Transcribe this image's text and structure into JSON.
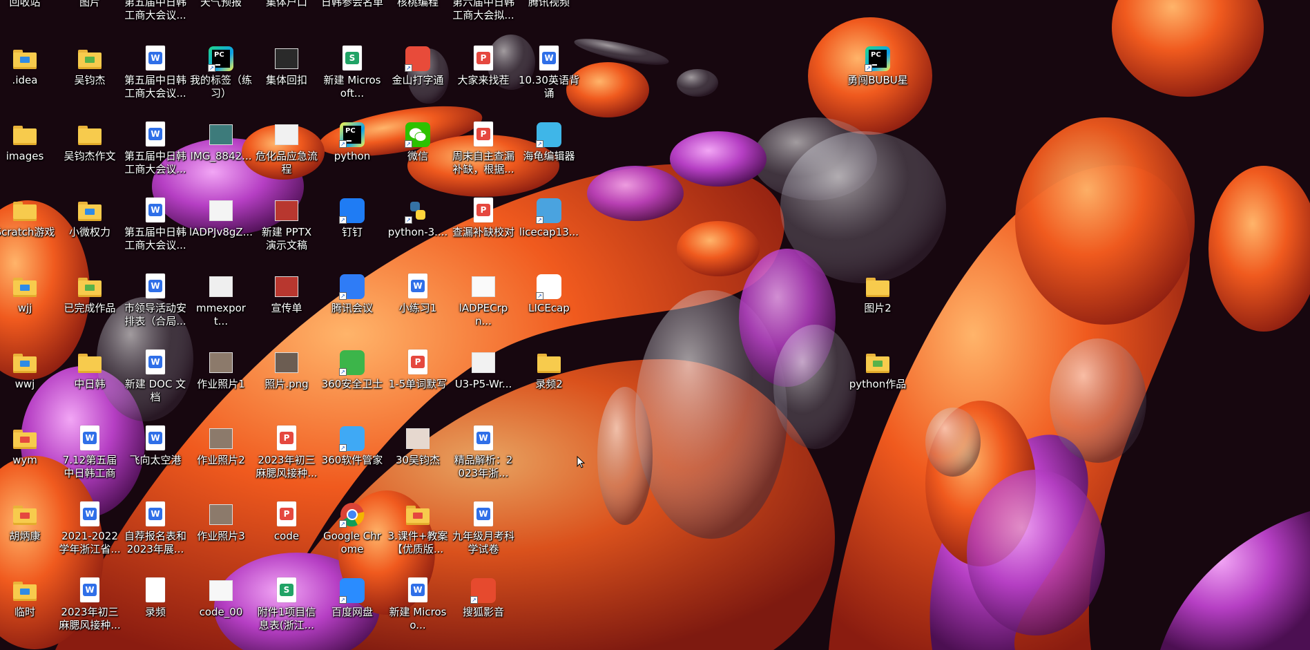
{
  "desktop": {
    "top_row": [
      "回收站",
      "图片",
      "第五届中日韩工商大会议...",
      "天气预报",
      "集体户口",
      "日韩参会名单",
      "核桃编程",
      "第六届中日韩工商大会拟...",
      "腾讯视频"
    ],
    "icons": [
      {
        "label": ".idea",
        "kind": "folder",
        "color": "#2f8be6"
      },
      {
        "label": "吴钧杰",
        "kind": "folder",
        "color": "#58b24a"
      },
      {
        "label": "第五届中日韩工商大会议...",
        "kind": "wps-doc",
        "color": "#2f6fe8"
      },
      {
        "label": "我的标签（练习）",
        "kind": "pycharm",
        "color": "#21d789"
      },
      {
        "label": "集体回扣",
        "kind": "image",
        "color": "#2a2a2a"
      },
      {
        "label": "新建 Microsoft...",
        "kind": "wps-sheet",
        "color": "#21a366"
      },
      {
        "label": "金山打字通",
        "kind": "app",
        "color": "#e84b3a"
      },
      {
        "label": "大家来找茬",
        "kind": "wps-pdf",
        "color": "#e5483f"
      },
      {
        "label": "10.30英语背诵",
        "kind": "wps-doc",
        "color": "#2f6fe8"
      },
      {
        "label": "勇闯BUBU星",
        "kind": "pycharm",
        "color": "#21d789"
      },
      {
        "label": "images",
        "kind": "folder",
        "color": "#f7cb4d"
      },
      {
        "label": "吴钧杰作文",
        "kind": "folder",
        "color": "#f7cb4d"
      },
      {
        "label": "第五届中日韩工商大会议...",
        "kind": "wps-doc",
        "color": "#2f6fe8"
      },
      {
        "label": "IMG_8842...",
        "kind": "image",
        "color": "#3d7b7b"
      },
      {
        "label": "危化品应急流程",
        "kind": "image",
        "color": "#f1f1f1"
      },
      {
        "label": "python",
        "kind": "pycharm",
        "color": "#fcf84a"
      },
      {
        "label": "微信",
        "kind": "wechat",
        "color": "#2dc100"
      },
      {
        "label": "周末自主查漏补缺，根据...",
        "kind": "wps-pdf",
        "color": "#e5483f"
      },
      {
        "label": "海龟编辑器",
        "kind": "app",
        "color": "#3fb6e8"
      },
      {
        "label": "Scratch游戏",
        "kind": "folder",
        "color": "#f7cb4d"
      },
      {
        "label": "小微权力",
        "kind": "folder",
        "color": "#2f8be6"
      },
      {
        "label": "第五届中日韩工商大会议...",
        "kind": "wps-doc",
        "color": "#2f6fe8"
      },
      {
        "label": "lADPJv8gZ...",
        "kind": "image",
        "color": "#f4f4f4"
      },
      {
        "label": "新建 PPTX 演示文稿",
        "kind": "image",
        "color": "#b8372f"
      },
      {
        "label": "钉钉",
        "kind": "app",
        "color": "#1f7cf4"
      },
      {
        "label": "python-3....",
        "kind": "python",
        "color": "#3572a5"
      },
      {
        "label": "查漏补缺校对",
        "kind": "wps-pdf",
        "color": "#e5483f"
      },
      {
        "label": "licecap13...",
        "kind": "app",
        "color": "#4aa3df"
      },
      {
        "label": "wjj",
        "kind": "folder",
        "color": "#2f8be6"
      },
      {
        "label": "已完成作品",
        "kind": "folder",
        "color": "#58b24a"
      },
      {
        "label": "市领导活动安排表（合局...",
        "kind": "wps-doc",
        "color": "#2f6fe8"
      },
      {
        "label": "mmexport...",
        "kind": "image",
        "color": "#efefef"
      },
      {
        "label": "宣传单",
        "kind": "image",
        "color": "#b8372f"
      },
      {
        "label": "腾讯会议",
        "kind": "app",
        "color": "#2f7cf6"
      },
      {
        "label": "小练习1",
        "kind": "wps-doc",
        "color": "#2f6fe8"
      },
      {
        "label": "lADPECrpn...",
        "kind": "image",
        "color": "#fafafa"
      },
      {
        "label": "LICEcap",
        "kind": "app",
        "color": "#ffffff"
      },
      {
        "label": "图片2",
        "kind": "folder",
        "color": "#f7cb4d"
      },
      {
        "label": "wwj",
        "kind": "folder",
        "color": "#2f8be6"
      },
      {
        "label": "中日韩",
        "kind": "folder",
        "color": "#f7cb4d"
      },
      {
        "label": "新建 DOC 文档",
        "kind": "wps-doc",
        "color": "#2f6fe8"
      },
      {
        "label": "作业照片1",
        "kind": "image",
        "color": "#8c7a6b"
      },
      {
        "label": "照片.png",
        "kind": "image",
        "color": "#6c5d52"
      },
      {
        "label": "360安全卫士",
        "kind": "app",
        "color": "#3cb54a"
      },
      {
        "label": "1-5单词默写",
        "kind": "wps-pdf",
        "color": "#e5483f"
      },
      {
        "label": "U3-P5-Wr...",
        "kind": "image",
        "color": "#f2f2f2"
      },
      {
        "label": "录频2",
        "kind": "folder",
        "color": "#f7cb4d"
      },
      {
        "label": "python作品",
        "kind": "folder",
        "color": "#58b24a"
      },
      {
        "label": "wym",
        "kind": "folder",
        "color": "#e5483f"
      },
      {
        "label": "7.12第五届中日韩工商大...",
        "kind": "wps-doc",
        "color": "#2f6fe8"
      },
      {
        "label": "飞向太空港",
        "kind": "wps-doc",
        "color": "#2f6fe8"
      },
      {
        "label": "作业照片2",
        "kind": "image",
        "color": "#8c7a6b"
      },
      {
        "label": "2023年初三麻腮风接种...",
        "kind": "wps-pdf",
        "color": "#e5483f"
      },
      {
        "label": "360软件管家",
        "kind": "app",
        "color": "#3fa9f5"
      },
      {
        "label": "30吴钧杰",
        "kind": "image",
        "color": "#e6d8cf"
      },
      {
        "label": "精品解析：2023年浙...",
        "kind": "wps-doc",
        "color": "#2f6fe8"
      },
      {
        "label": "胡炳康",
        "kind": "folder",
        "color": "#e5483f"
      },
      {
        "label": "2021-2022学年浙江省...",
        "kind": "wps-doc",
        "color": "#2f6fe8"
      },
      {
        "label": "自荐报名表和2023年展...",
        "kind": "wps-doc",
        "color": "#2f6fe8"
      },
      {
        "label": "作业照片3",
        "kind": "image",
        "color": "#8c7a6b"
      },
      {
        "label": "code",
        "kind": "wps-pdf",
        "color": "#e5483f"
      },
      {
        "label": "Google Chrome",
        "kind": "chrome",
        "color": "#4285f4"
      },
      {
        "label": "3.课件+教案【优质版...",
        "kind": "folder",
        "color": "#e5483f"
      },
      {
        "label": "九年级月考科学试卷",
        "kind": "wps-doc",
        "color": "#2f6fe8"
      },
      {
        "label": "临时",
        "kind": "folder",
        "color": "#2f8be6"
      },
      {
        "label": "2023年初三麻腮风接种...",
        "kind": "wps-doc",
        "color": "#2f6fe8"
      },
      {
        "label": "录频",
        "kind": "blank",
        "color": "#ffffff"
      },
      {
        "label": "code_00",
        "kind": "image",
        "color": "#f7f7f7"
      },
      {
        "label": "附件1项目信息表(浙江...",
        "kind": "wps-sheet",
        "color": "#21a366"
      },
      {
        "label": "百度网盘",
        "kind": "app",
        "color": "#2a8cff"
      },
      {
        "label": "新建 Microso...",
        "kind": "wps-doc",
        "color": "#2f6fe8"
      },
      {
        "label": "搜狐影音",
        "kind": "app",
        "color": "#e64a2e"
      }
    ]
  }
}
